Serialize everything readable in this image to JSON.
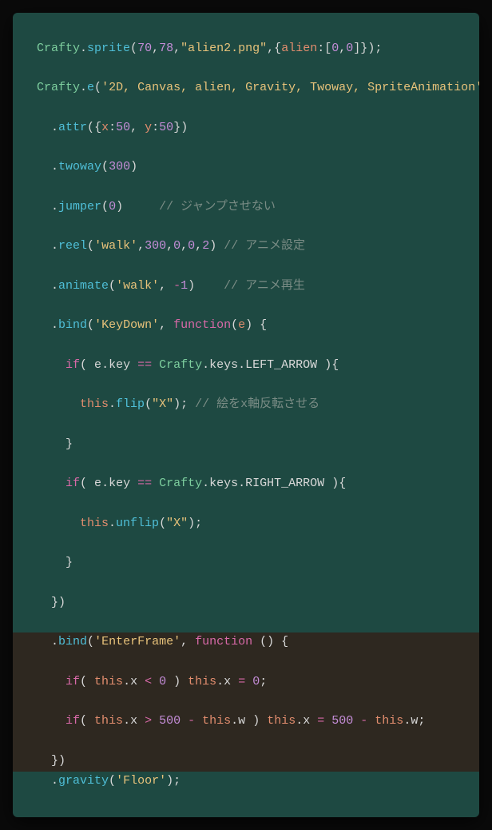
{
  "code": {
    "l1": {
      "craftySprite": "Crafty",
      "dot1": ".",
      "sprite": "sprite",
      "op": "(",
      "n1": "70",
      "c1": ",",
      "n2": "78",
      "c2": ",",
      "s1": "\"alien2.png\"",
      "c3": ",",
      "ob": "{",
      "k1": "alien",
      "col": ":",
      "ab": "[",
      "z1": "0",
      "cc": ",",
      "z2": "0",
      "ae": "]",
      "oe": "}",
      "cp": ")",
      "sc": ";"
    },
    "l2": {
      "crafty": "Crafty",
      "dot": ".",
      "e": "e",
      "op": "(",
      "s": "'2D, Canvas, alien, Gravity, Twoway, SpriteAnimation'",
      "cp": ")"
    },
    "l3": {
      "dot": ".",
      "attr": "attr",
      "op": "(",
      "ob": "{",
      "kx": "x",
      "c1": ":",
      "vx": "50",
      "cm": ", ",
      "ky": "y",
      "c2": ":",
      "vy": "50",
      "oe": "}",
      "cp": ")"
    },
    "l4": {
      "dot": ".",
      "twoway": "twoway",
      "op": "(",
      "n": "300",
      "cp": ")"
    },
    "l5": {
      "dot": ".",
      "jumper": "jumper",
      "op": "(",
      "n": "0",
      "cp": ")",
      "comment": "// ジャンプさせない"
    },
    "l6": {
      "dot": ".",
      "reel": "reel",
      "op": "(",
      "s": "'walk'",
      "c1": ",",
      "n1": "300",
      "c2": ",",
      "n2": "0",
      "c3": ",",
      "n3": "0",
      "c4": ",",
      "n4": "2",
      "cp": ")",
      "comment": "// アニメ設定"
    },
    "l7": {
      "dot": ".",
      "animate": "animate",
      "op": "(",
      "s": "'walk'",
      "c": ", ",
      "neg": "-",
      "n": "1",
      "cp": ")",
      "comment": "// アニメ再生"
    },
    "l8": {
      "dot": ".",
      "bind": "bind",
      "op": "(",
      "s": "'KeyDown'",
      "c": ", ",
      "fn": "function",
      "op2": "(",
      "p": "e",
      "cp2": ")",
      "ob": " {"
    },
    "l9": {
      "if": "if",
      "op": "( ",
      "e": "e",
      "dot": ".",
      "key": "key",
      "eq": " == ",
      "crafty": "Crafty",
      "dot2": ".",
      "keys": "keys",
      "dot3": ".",
      "arrow": "LEFT_ARROW",
      "cp": " ){"
    },
    "l10": {
      "this": "this",
      "dot": ".",
      "flip": "flip",
      "op": "(",
      "s": "\"X\"",
      "cp": ")",
      "sc": ";",
      "comment": " // 絵をx軸反転させる"
    },
    "l11": {
      "cb": "}"
    },
    "l12": {
      "if": "if",
      "op": "( ",
      "e": "e",
      "dot": ".",
      "key": "key",
      "eq": " == ",
      "crafty": "Crafty",
      "dot2": ".",
      "keys": "keys",
      "dot3": ".",
      "arrow": "RIGHT_ARROW",
      "cp": " ){"
    },
    "l13": {
      "this": "this",
      "dot": ".",
      "unflip": "unflip",
      "op": "(",
      "s": "\"X\"",
      "cp": ")",
      "sc": ";"
    },
    "l14": {
      "cb": "}"
    },
    "l15": {
      "cb": "})"
    },
    "l16": {
      "dot": ".",
      "bind": "bind",
      "op": "(",
      "s": "'EnterFrame'",
      "c": ", ",
      "fn": "function",
      "op2": " ()",
      "ob": " {"
    },
    "l17": {
      "if": "if",
      "op": "( ",
      "this": "this",
      "dot": ".",
      "x": "x",
      "lt": " < ",
      "z": "0",
      "cp": " ) ",
      "this2": "this",
      "dot2": ".",
      "x2": "x",
      "eq": " = ",
      "z2": "0",
      "sc": ";"
    },
    "l18": {
      "if": "if",
      "op": "( ",
      "this": "this",
      "dot": ".",
      "x": "x",
      "gt": " > ",
      "n": "500",
      "m": " - ",
      "this2": "this",
      "dot2": ".",
      "w": "w",
      "cp": " ) ",
      "this3": "this",
      "dot3": ".",
      "x2": "x",
      "eq": " = ",
      "n2": "500",
      "m2": " - ",
      "this4": "this",
      "dot4": ".",
      "w2": "w",
      "sc": ";"
    },
    "l19": {
      "cb": "})"
    },
    "l20": {
      "dot": ".",
      "gravity": "gravity",
      "op": "(",
      "s": "'Floor'",
      "cp": ")",
      "sc": ";"
    }
  }
}
